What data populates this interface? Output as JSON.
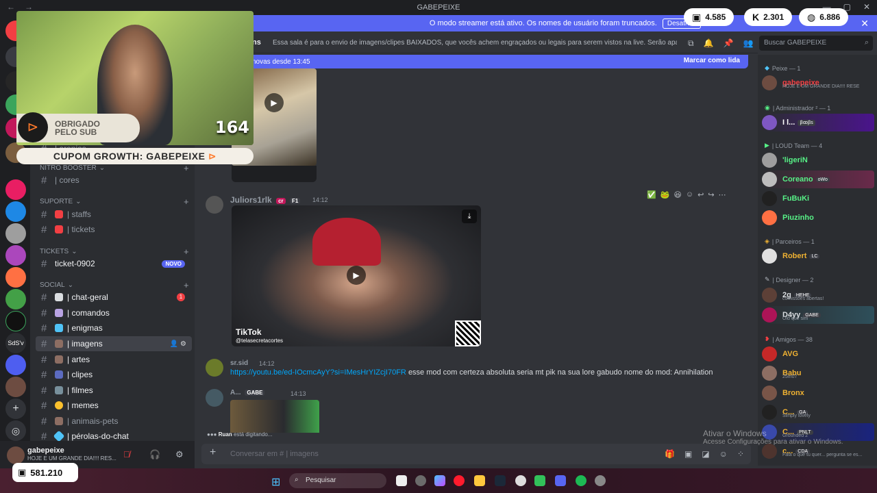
{
  "window": {
    "title": "GABEPEIXE",
    "controls": [
      "—",
      "▢",
      "✕"
    ]
  },
  "streamer_notice": {
    "text": "O modo streamer está ativo. Os nomes de usuário foram truncados.",
    "button": "Desativar"
  },
  "overlay": {
    "sub_text_line1": "OBRIGADO",
    "sub_text_line2": "PELO SUB",
    "sub_count": "164",
    "coupon_prefix": "CUPOM GROWTH:",
    "coupon_code": "GABEPEIXE",
    "points": [
      {
        "icon": "channel-points-icon",
        "value": "4.585"
      },
      {
        "icon": "kick-icon",
        "value": "2.301"
      },
      {
        "icon": "globe-icon",
        "value": "6.886"
      }
    ],
    "gold_value": "581.210"
  },
  "header": {
    "channel_fragment": "ns",
    "topic": "Essa sala é para o envio de imagens/clipes BAIXADOS, que vocês achem engraçados ou legais para serem vistos na live. Serão apagados prints de o...",
    "search_placeholder": "Buscar GABEPEIXE"
  },
  "new_messages": {
    "text": "novas desde 13:45",
    "mark_read": "Marcar como lida"
  },
  "sidebar": {
    "partial_top": "| aranias",
    "categories": [
      {
        "name": "NITRO BOOSTER",
        "channels": [
          {
            "name": "| cores"
          }
        ]
      },
      {
        "name": "SUPORTE",
        "channels": [
          {
            "name": "| staffs"
          },
          {
            "name": "| tickets"
          }
        ]
      },
      {
        "name": "TICKETS",
        "channels": [
          {
            "name": "ticket-0902",
            "badge": "NOVO"
          }
        ]
      },
      {
        "name": "SOCIAL",
        "channels": [
          {
            "name": "| chat-geral",
            "mention": "1"
          },
          {
            "name": "| comandos"
          },
          {
            "name": "| enigmas"
          },
          {
            "name": "| imagens",
            "active": true
          },
          {
            "name": "| artes"
          },
          {
            "name": "| clipes"
          },
          {
            "name": "| filmes"
          },
          {
            "name": "| memes"
          },
          {
            "name": "| animais-pets"
          },
          {
            "name": "| pérolas-do-chat"
          }
        ]
      }
    ]
  },
  "user": {
    "name": "gabepeixe",
    "status": "HOJE E UM GRANDE DIA!!!! RES..."
  },
  "messages": [
    {
      "author": "Julio",
      "author_suffix": "rs1rlk",
      "tag1": "cr",
      "tag2": "F1",
      "time": "14:12",
      "video_watermark": "TikTok",
      "video_handle": "@telasecretacortes"
    },
    {
      "author": "sr.sid",
      "time": "14:12",
      "link": "https://youtu.be/ed-IOcmcAyY?si=IMesHrYIZcjI70FR",
      "text": "esse mod com certeza absoluta seria mt pik na sua lore gabudo nome do mod: Annihilation"
    },
    {
      "author": "A...",
      "tag": "GABE",
      "time": "14:13"
    }
  ],
  "typing": {
    "user": "Ruan",
    "text": "está digitando..."
  },
  "composer": {
    "placeholder": "Conversar em #",
    "channel": "| imagens"
  },
  "members": {
    "roles": [
      {
        "name": "Peixe — 1"
      },
      {
        "name": "| Administrador ² — 1"
      },
      {
        "name": "| LOUD Team — 4"
      },
      {
        "name": "| Parceiros — 1"
      },
      {
        "name": "| Designer — 2"
      },
      {
        "name": "| Amigos — 38"
      }
    ],
    "list": [
      {
        "name": "gabepeixe",
        "sub": "HOJE E UM GRANDE DIA!!!! RESE",
        "color": "#f23f43"
      },
      {
        "name": "I l...",
        "tag": "ꞵꝏꞵs",
        "color": "#ffffff"
      },
      {
        "name": "'ligeriN",
        "color": "#57f287"
      },
      {
        "name": "Coreano",
        "tag": "oWo",
        "color": "#57f287"
      },
      {
        "name": "FuBuKi",
        "color": "#57f287"
      },
      {
        "name": "Piuzinho",
        "color": "#57f287"
      },
      {
        "name": "Robert",
        "tag": "LC",
        "color": "#f0b232"
      },
      {
        "name": "2g",
        "tag": "HEHE",
        "sub": "comissões abertas!",
        "color": "#dbdee1"
      },
      {
        "name": "D4yy",
        "tag": "GABE",
        "sub": "Old que sim",
        "color": "#dbdee1"
      },
      {
        "name": "AVG",
        "color": "#f0b232"
      },
      {
        "name": "Babu",
        "sub": "25m07",
        "color": "#f0b232"
      },
      {
        "name": "Bronx",
        "color": "#f0b232"
      },
      {
        "name": "C...",
        "tag": "GA",
        "sub": "Simply lovely",
        "color": "#f0b232"
      },
      {
        "name": "C...",
        "tag": "PNLT",
        "sub": "Grounded 2",
        "color": "#f0b232"
      },
      {
        "name": "c...",
        "tag": "CDA",
        "sub": "Fala o que tu quer... pergunta se es...",
        "color": "#f0b232"
      }
    ]
  },
  "windows_activation": {
    "title": "Ativar o Windows",
    "subtitle": "Acesse Configurações para ativar o Windows."
  },
  "taskbar": {
    "search_placeholder": "Pesquisar"
  }
}
